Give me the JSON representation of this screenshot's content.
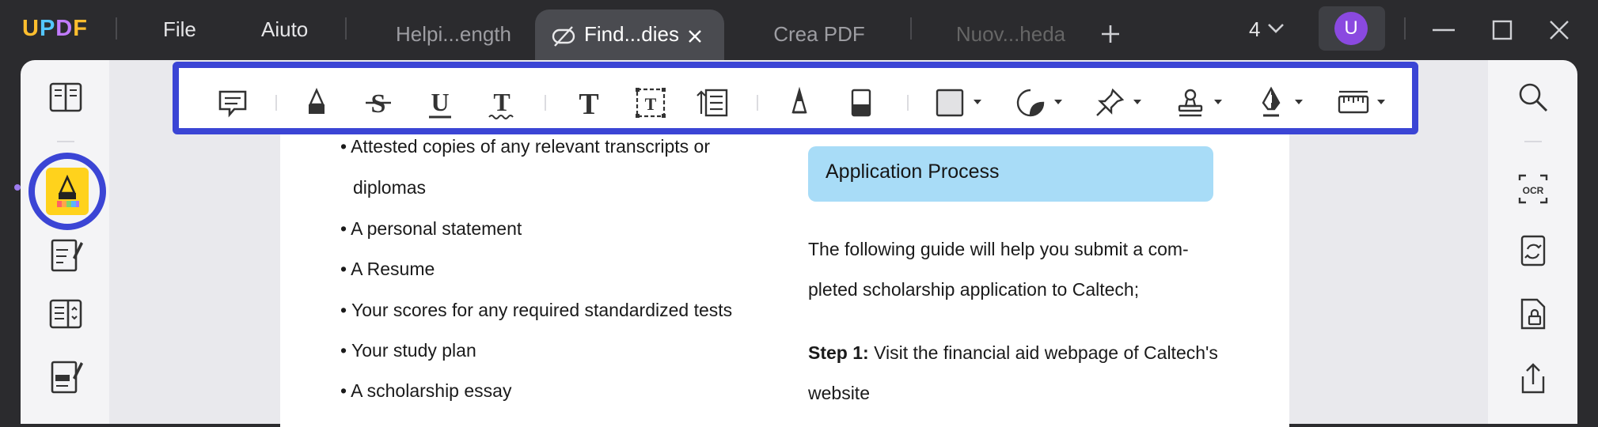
{
  "app": {
    "logo": "UPDF"
  },
  "menu": {
    "file": "File",
    "help": "Aiuto"
  },
  "tabs": [
    {
      "label": "Helpi...ength"
    },
    {
      "label": "Find...dies"
    },
    {
      "label": "Crea PDF"
    },
    {
      "label": "Nuov...heda"
    }
  ],
  "titlebar": {
    "page_count": "4",
    "avatar_initial": "U"
  },
  "toolbar": {
    "tools": [
      "comment-icon",
      "highlight-icon",
      "strikethrough-icon",
      "underline-icon",
      "squiggly-icon",
      "text-icon",
      "textbox-icon",
      "text-callout-icon",
      "pencil-icon",
      "eraser-icon",
      "shape-icon",
      "sticker-icon",
      "pin-icon",
      "stamp-icon",
      "signature-icon",
      "measure-icon"
    ]
  },
  "document": {
    "left_column": [
      "• Attested copies of any relevant transcripts or",
      "diplomas",
      "• A personal statement",
      "• A Resume",
      "• Your scores for any required standardized tests",
      "• Your study plan",
      "• A scholarship essay"
    ],
    "section_title": "Application Process",
    "right_column": [
      "The following guide will help you submit a com-",
      "pleted scholarship application to Caltech;"
    ],
    "step1_label": "Step 1:",
    "step1_text": " Visit the financial aid webpage of Caltech's",
    "step1_cont": "website"
  },
  "colors": {
    "accent": "#3b45d5",
    "highlight": "#ffd21c",
    "badge": "#a8dcf7",
    "avatar": "#8a49e0"
  }
}
